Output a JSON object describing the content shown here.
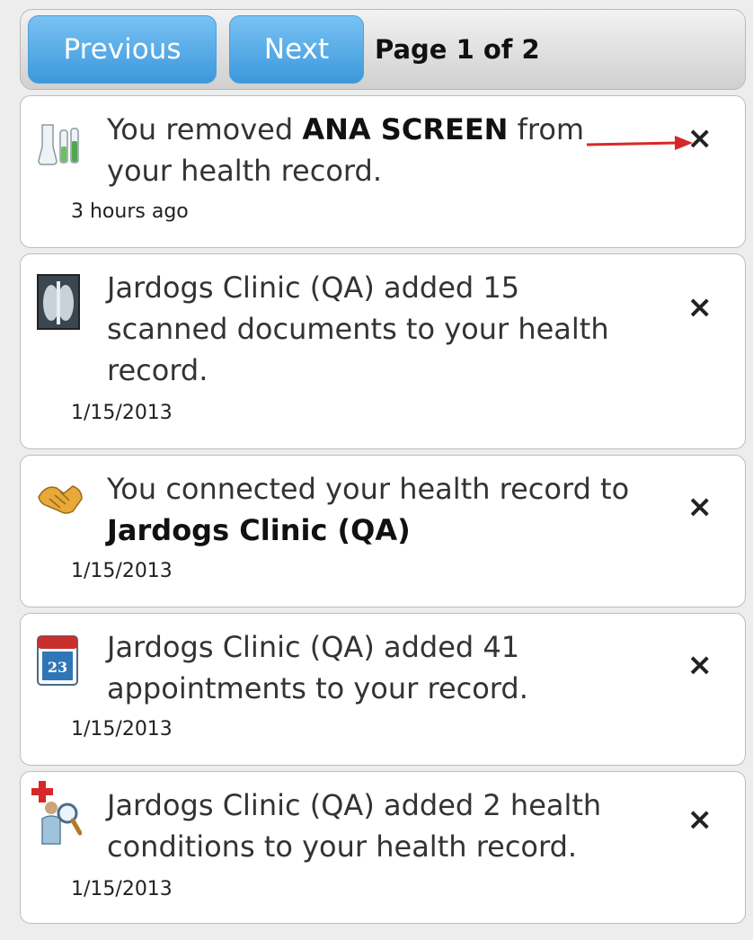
{
  "pager": {
    "previous_label": "Previous",
    "next_label": "Next",
    "page_label": "Page 1 of 2"
  },
  "notifications": [
    {
      "icon": "lab-flask-icon",
      "text_pre": "You removed ",
      "text_bold": "ANA SCREEN",
      "text_post": " from your health record.",
      "time": "3 hours ago",
      "close": "×"
    },
    {
      "icon": "xray-icon",
      "text_pre": "Jardogs Clinic (QA) added 15 scanned documents to your health record.",
      "time": "1/15/2013",
      "close": "×"
    },
    {
      "icon": "handshake-icon",
      "text_pre": "You connected your health record to ",
      "text_bold": "Jardogs Clinic (QA)",
      "time": "1/15/2013",
      "close": "×"
    },
    {
      "icon": "calendar-icon",
      "calendar_day": "23",
      "text_pre": "Jardogs Clinic (QA) added 41 appointments to your record.",
      "time": "1/15/2013",
      "close": "×"
    },
    {
      "icon": "health-conditions-icon",
      "text_pre": "Jardogs Clinic (QA) added 2 health conditions to your health record.",
      "time": "1/15/2013",
      "close": "×"
    }
  ],
  "colors": {
    "button_blue": "#3c98dc",
    "arrow_red": "#d62828"
  }
}
